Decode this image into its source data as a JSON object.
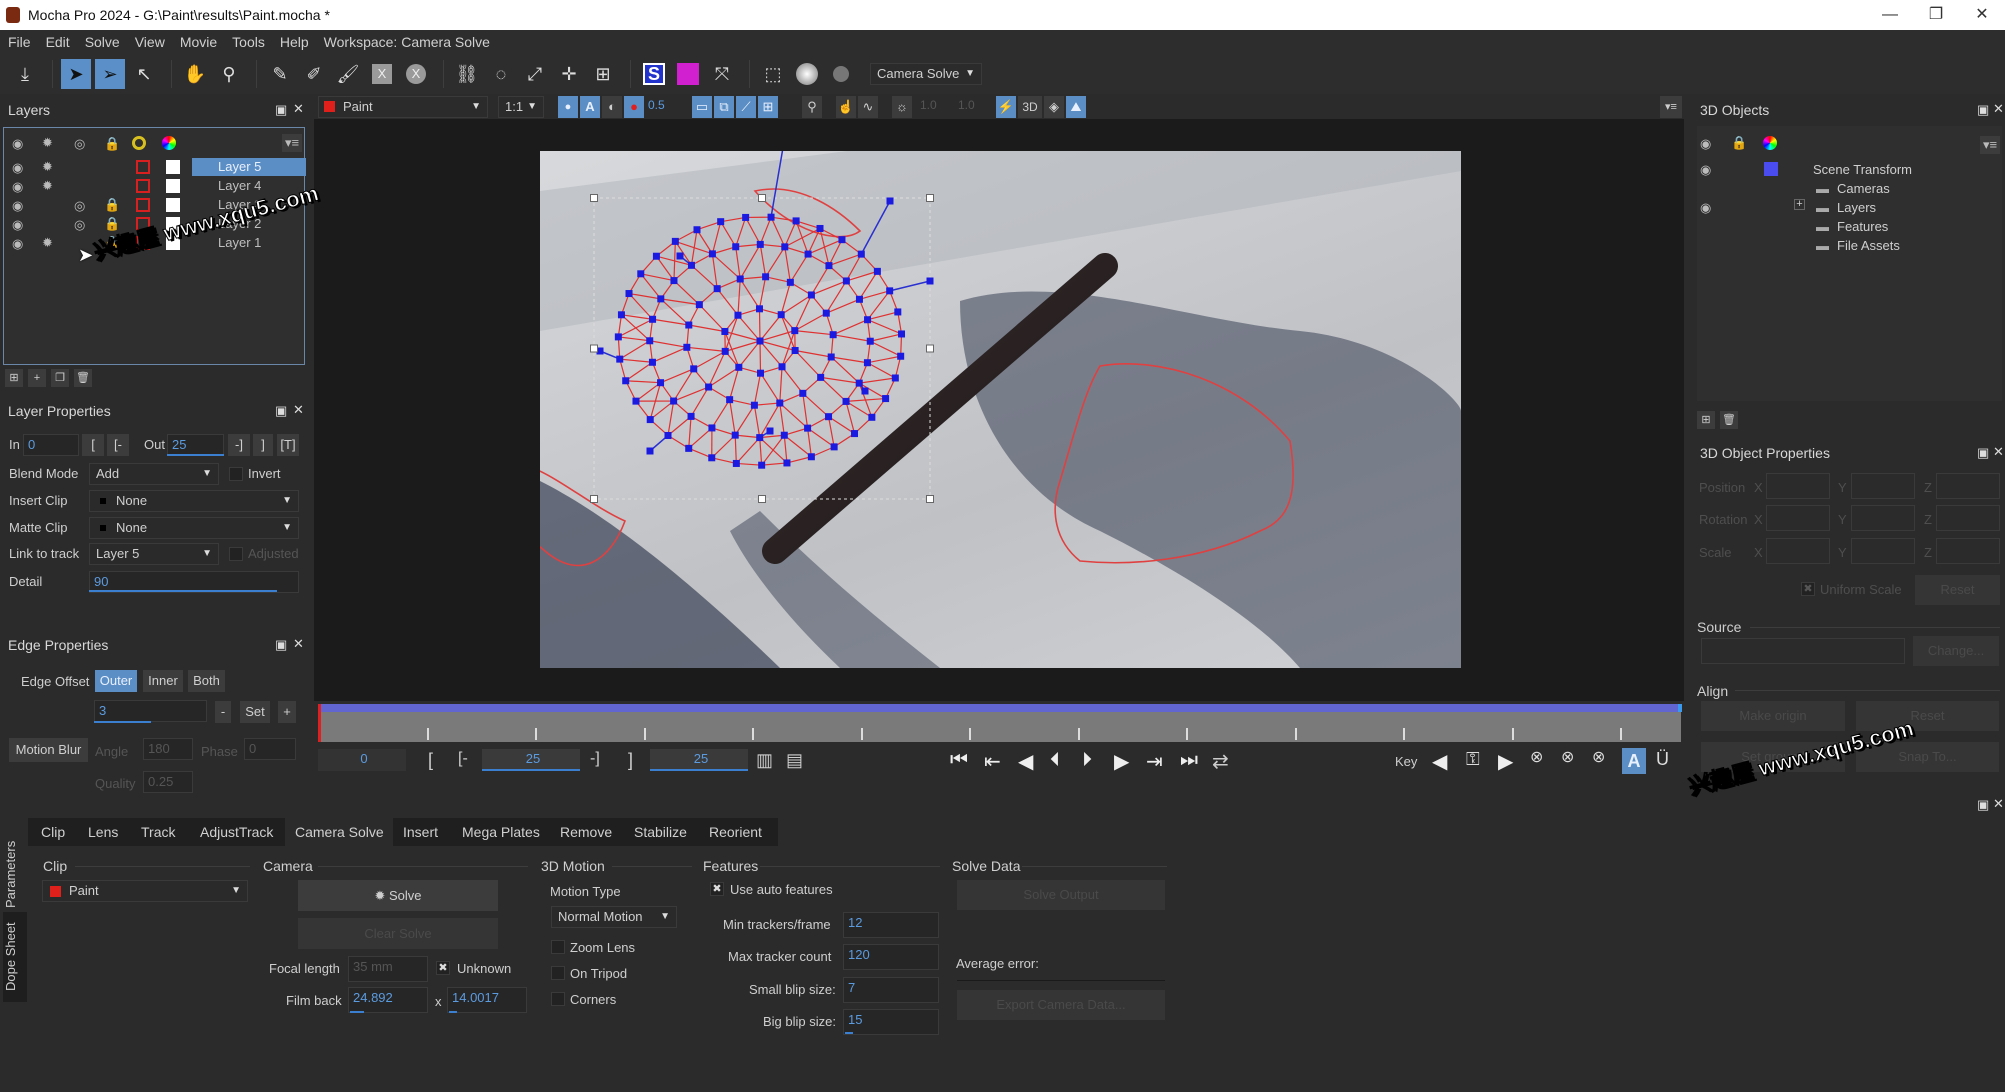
{
  "window": {
    "title": "Mocha Pro 2024 - G:\\Paint\\results\\Paint.mocha *",
    "min": "—",
    "restore": "❐",
    "close": "✕"
  },
  "menu": [
    "File",
    "Edit",
    "Solve",
    "View",
    "Movie",
    "Tools",
    "Help",
    "Workspace: Camera Solve"
  ],
  "toolbar": {
    "icons": [
      "export-icon",
      "select-icon",
      "select-b-icon",
      "add-point-icon",
      "hand-icon",
      "zoom-icon",
      "xspline-icon",
      "bezier-icon",
      "brush-icon",
      "x-rect-icon",
      "x-circle-icon",
      "link-icon",
      "lasso-icon",
      "scale-icon",
      "move-icon",
      "surface-icon",
      "surface-s-icon",
      "grid-icon",
      "stabilize-icon",
      "crop-icon",
      "orbit-icon",
      "tape-icon"
    ],
    "workspace_dropdown": "Camera Solve"
  },
  "layers_panel": {
    "title": "Layers",
    "layers": [
      {
        "name": "Layer 5",
        "selected": true,
        "visible": true,
        "cog": true,
        "link": false,
        "lock": false
      },
      {
        "name": "Layer 4",
        "selected": false,
        "visible": true,
        "cog": true,
        "link": false,
        "lock": false
      },
      {
        "name": "Layer 3",
        "selected": false,
        "visible": true,
        "cog": false,
        "link": true,
        "lock": true
      },
      {
        "name": "Layer 2",
        "selected": false,
        "visible": true,
        "cog": false,
        "link": true,
        "lock": true
      },
      {
        "name": "Layer 1",
        "selected": false,
        "visible": true,
        "cog": true,
        "link": false,
        "lock": true
      }
    ]
  },
  "layer_properties": {
    "title": "Layer Properties",
    "in_label": "In",
    "in_value": "0",
    "out_label": "Out",
    "out_value": "25",
    "blend_mode_label": "Blend Mode",
    "blend_mode": "Add",
    "invert_label": "Invert",
    "insert_clip_label": "Insert Clip",
    "insert_clip": "None",
    "matte_clip_label": "Matte Clip",
    "matte_clip": "None",
    "link_track_label": "Link to track",
    "link_track": "Layer 5",
    "adjusted_label": "Adjusted",
    "detail_label": "Detail",
    "detail_value": "90"
  },
  "edge_properties": {
    "title": "Edge Properties",
    "edge_offset_label": "Edge Offset",
    "modes": [
      "Outer",
      "Inner",
      "Both"
    ],
    "active_mode": "Outer",
    "offset_value": "3",
    "minus": "-",
    "set": "Set",
    "plus": "+",
    "motion_blur_label": "Motion Blur",
    "angle_label": "Angle",
    "angle_value": "180",
    "phase_label": "Phase",
    "phase_value": "0",
    "quality_label": "Quality",
    "quality_value": "0.25"
  },
  "viewer_bar": {
    "clip": "Paint",
    "clip_color": "#e0201a",
    "zoom": "1:1",
    "opacity": "0.5",
    "exposure1": "1.0",
    "exposure2": "1.0",
    "mode_3d": "3D"
  },
  "timeline": {
    "current_frame": "0",
    "in_point": "25",
    "out_point": "25",
    "key_label": "Key",
    "progress": 1.0
  },
  "objects3d": {
    "title": "3D Objects",
    "root": "Scene Transform",
    "root_color": "#4a4cf0",
    "children": [
      "Cameras",
      "Layers",
      "Features",
      "File Assets"
    ]
  },
  "object_props": {
    "title": "3D Object Properties",
    "rows": [
      "Position",
      "Rotation",
      "Scale"
    ],
    "axes": [
      "X",
      "Y",
      "Z"
    ],
    "uniform_scale": "Uniform Scale",
    "reset": "Reset",
    "source_label": "Source",
    "change": "Change...",
    "align_label": "Align",
    "make_origin": "Make origin",
    "align_reset": "Reset",
    "set_ground": "Set ground",
    "snap_to": "Snap To..."
  },
  "parameters": {
    "side_tabs": [
      "Parameters",
      "Dope Sheet"
    ],
    "tabs": [
      "Clip",
      "Lens",
      "Track",
      "AdjustTrack",
      "Camera Solve",
      "Insert",
      "Mega Plates",
      "Remove",
      "Stabilize",
      "Reorient"
    ],
    "active_tab": "Camera Solve",
    "clip_section": "Clip",
    "clip_value": "Paint",
    "camera_section": "Camera",
    "solve": "Solve",
    "clear_solve": "Clear Solve",
    "focal_length_label": "Focal length",
    "focal_length": "35 mm",
    "unknown_label": "Unknown",
    "film_back_label": "Film back",
    "film_back_w": "24.892",
    "film_back_x": "x",
    "film_back_h": "14.0017",
    "motion_section": "3D Motion",
    "motion_type_label": "Motion Type",
    "motion_type": "Normal Motion",
    "zoom_lens": "Zoom Lens",
    "on_tripod": "On Tripod",
    "corners": "Corners",
    "features_section": "Features",
    "use_auto": "Use auto features",
    "min_trackers_label": "Min trackers/frame",
    "min_trackers": "12",
    "max_tracker_label": "Max tracker count",
    "max_tracker": "120",
    "small_blip_label": "Small blip size:",
    "small_blip": "7",
    "big_blip_label": "Big blip size:",
    "big_blip": "15",
    "solve_data_section": "Solve Data",
    "solve_output": "Solve Output",
    "avg_error_label": "Average error:",
    "export_camera": "Export Camera Data..."
  },
  "watermark": "兴趣屋 www.xqu5.com"
}
